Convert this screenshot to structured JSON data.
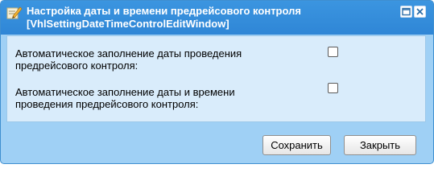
{
  "window": {
    "title_line1": "Настройка даты и времени предрейсового контроля",
    "title_line2": "[VhlSettingDateTimeControlEditWindow]",
    "icon": "edit-pencil-icon",
    "controls": [
      "maximize-icon",
      "close-icon"
    ]
  },
  "form": {
    "fields": [
      {
        "label_line1": "Автоматическое заполнение даты проведения",
        "label_line2": "предрейсового контроля:",
        "checked": false
      },
      {
        "label_line1": "Автоматическое заполнение даты и времени",
        "label_line2": "проведения предрейсового контроля:",
        "checked": false
      }
    ]
  },
  "footer": {
    "save_label": "Сохранить",
    "close_label": "Закрыть"
  },
  "colors": {
    "titlebar": "#3b95e0",
    "window_bg": "#9fd0f5",
    "panel_bg": "#d9ecfb"
  }
}
